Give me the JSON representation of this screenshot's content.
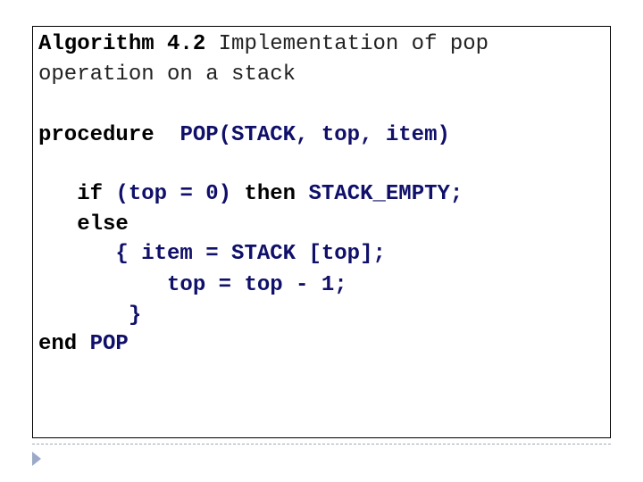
{
  "title": {
    "label": "Algorithm 4.2",
    "text_line1": " Implementation of pop",
    "text_line2": "operation on a stack"
  },
  "code": {
    "proc_kw": "procedure",
    "proc_sig": "POP(STACK, top, item)",
    "if_kw": "if",
    "if_cond": "(top = 0)",
    "then_kw": "then",
    "then_stmt": "STACK_EMPTY;",
    "else_kw": "else",
    "stmt1": "{ item = STACK [top];",
    "stmt2": "top = top - 1;",
    "close_brace": "}",
    "end_kw": "end",
    "end_name": "POP"
  },
  "footer": {
    "bullet_icon": "triangle-bullet"
  }
}
